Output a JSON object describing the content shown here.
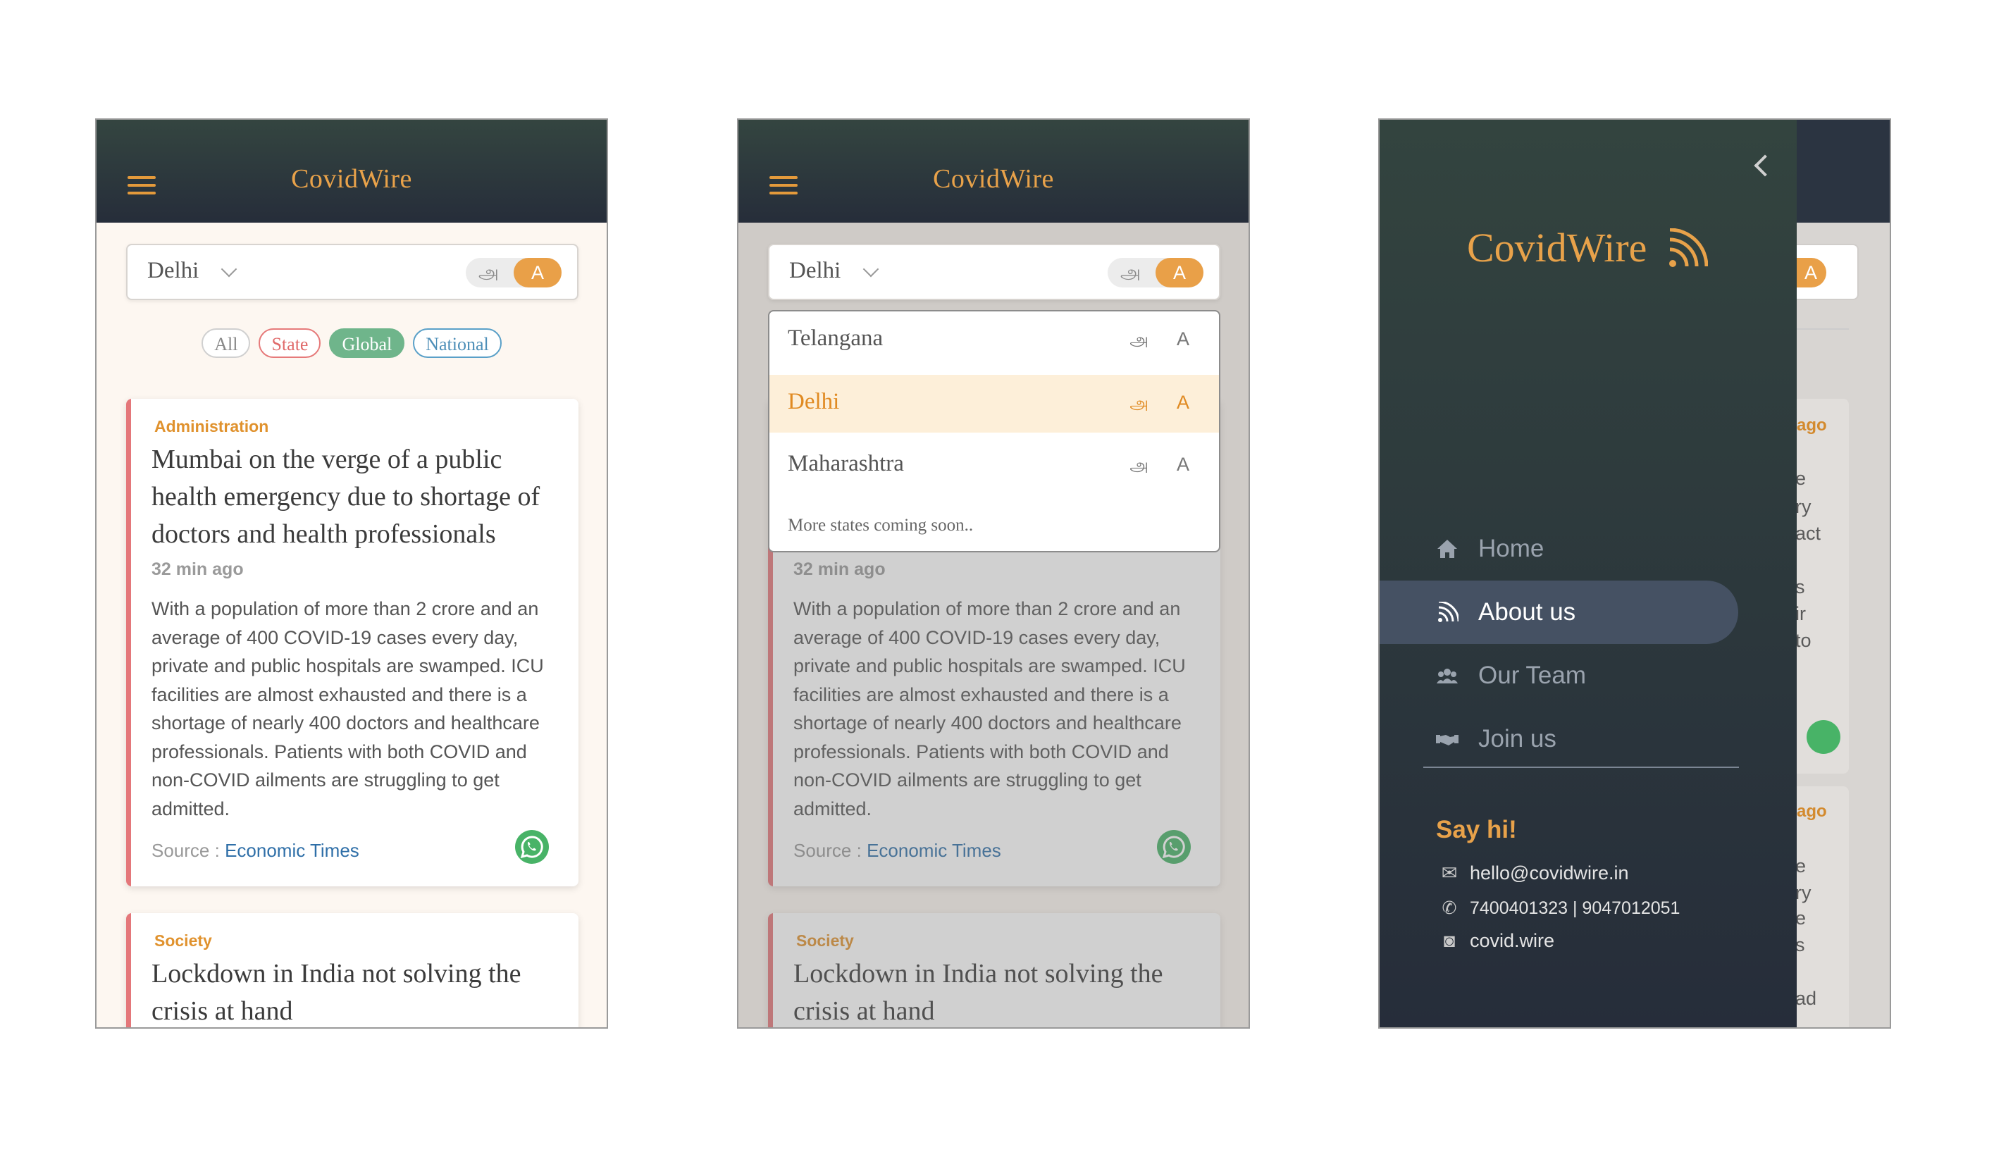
{
  "app": {
    "brand": "CovidWire"
  },
  "select": {
    "value": "Delhi",
    "lang_tamil": "அ",
    "lang_english": "A"
  },
  "filters": {
    "all": "All",
    "state": "State",
    "global": "Global",
    "national": "National"
  },
  "articles": [
    {
      "category": "Administration",
      "title": "Mumbai on the verge of a public health emergency due to shortage of doctors and health professionals",
      "time": "32 min ago",
      "body": "With a population of more than 2 crore and an average of 400 COVID-19 cases every day, private and public hospitals are swamped. ICU facilities are almost exhausted and there is a shortage of nearly 400 doctors and healthcare professionals. Patients with both COVID and non-COVID ailments are struggling to get admitted.",
      "source_label": "Source :",
      "source": "Economic Times"
    },
    {
      "category": "Society",
      "title": "Lockdown in India not solving the crisis at hand"
    }
  ],
  "dropdown": {
    "options": [
      {
        "label": "Telangana",
        "ta": "அ",
        "en": "A"
      },
      {
        "label": "Delhi",
        "ta": "அ",
        "en": "A"
      },
      {
        "label": "Maharashtra",
        "ta": "அ",
        "en": "A"
      }
    ],
    "note": "More states coming soon.."
  },
  "drawer": {
    "brand": "CovidWire",
    "menu": [
      {
        "label": "Home",
        "icon": "home-icon"
      },
      {
        "label": "About us",
        "icon": "rss-icon"
      },
      {
        "label": "Our Team",
        "icon": "team-icon"
      },
      {
        "label": "Join us",
        "icon": "handshake-icon"
      }
    ],
    "say_hi": "Say hi!",
    "email": "hello@covidwire.in",
    "phone": "7400401323 | 9047012051",
    "instagram": "covid.wire"
  },
  "peek": {
    "ago": "ago",
    "fragments": [
      "e",
      "ry",
      "act",
      "s",
      "ir",
      "to",
      "e",
      "ry",
      "e",
      "s",
      "ad"
    ]
  },
  "colors": {
    "accent": "#e8a24a",
    "header": "#2b3441",
    "card_accent": "#e4777a",
    "whatsapp": "#48b367",
    "link": "#2f6fa8"
  }
}
